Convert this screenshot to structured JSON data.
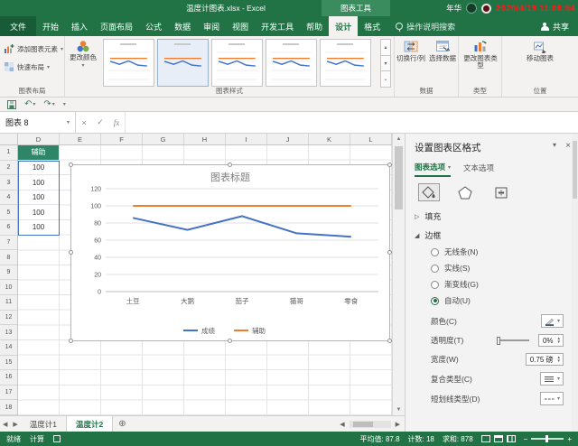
{
  "colors": {
    "excel_green": "#217346",
    "series_blue": "#4472c4",
    "series_orange": "#ed7d31",
    "d1_fill": "#2e8568"
  },
  "title_bar": {
    "window_title": "温度计图表.xlsx - Excel",
    "context_title": "图表工具",
    "user_name": "年华",
    "timestamp": "2020/4/19 11:06:54"
  },
  "ribbon": {
    "file_tab": "文件",
    "tabs": [
      {
        "label": "开始"
      },
      {
        "label": "插入"
      },
      {
        "label": "页面布局"
      },
      {
        "label": "公式"
      },
      {
        "label": "数据"
      },
      {
        "label": "审阅"
      },
      {
        "label": "视图"
      },
      {
        "label": "开发工具"
      },
      {
        "label": "帮助"
      },
      {
        "label": "设计",
        "active": true
      },
      {
        "label": "格式"
      }
    ],
    "search_label": "操作说明搜索",
    "share_label": "共享",
    "groups": [
      {
        "label": "图表布局"
      },
      {
        "label": "图表样式"
      },
      {
        "label": "数据"
      },
      {
        "label": "类型"
      },
      {
        "label": "位置"
      }
    ],
    "add_chart_element": "添加图表元素",
    "quick_layout": "快速布局",
    "change_colors": "更改颜色",
    "switch_row_col": "切换行/列",
    "select_data": "选择数据",
    "change_chart_type": "更改图表类型",
    "move_chart": "移动图表"
  },
  "formula_bar": {
    "name_box": "图表 8"
  },
  "sheet": {
    "columns": [
      "D",
      "E",
      "F",
      "G",
      "H",
      "I",
      "J",
      "K",
      "L"
    ],
    "row_numbers": [
      "1",
      "2",
      "3",
      "4",
      "5",
      "6",
      "7",
      "8",
      "9",
      "10",
      "11",
      "12",
      "13",
      "14",
      "15",
      "16",
      "17",
      "18"
    ],
    "d1_value": "辅助",
    "d_values": [
      "100",
      "100",
      "100",
      "100",
      "100"
    ],
    "tabs": [
      {
        "label": "温度计1"
      },
      {
        "label": "温度计2",
        "active": true
      }
    ]
  },
  "chart_data": {
    "type": "line",
    "title": "图表标题",
    "categories": [
      "土豆",
      "大鹅",
      "茄子",
      "猫哥",
      "零食"
    ],
    "series": [
      {
        "name": "成绩",
        "color": "#4472c4",
        "values": [
          86,
          72,
          88,
          68,
          64
        ]
      },
      {
        "name": "辅助",
        "color": "#ed7d31",
        "values": [
          100,
          100,
          100,
          100,
          100
        ]
      }
    ],
    "ylim": [
      0,
      120
    ],
    "yticks": [
      0,
      20,
      40,
      60,
      80,
      100,
      120
    ],
    "grid": true,
    "legend_position": "bottom"
  },
  "format_pane": {
    "title": "设置图表区格式",
    "tab_chart_options": "图表选项",
    "tab_text_options": "文本选项",
    "section_fill": "填充",
    "section_border": "边框",
    "border_options": [
      {
        "label": "无线条(N)"
      },
      {
        "label": "实线(S)"
      },
      {
        "label": "渐变线(G)"
      },
      {
        "label": "自动(U)",
        "selected": true
      }
    ],
    "color_label": "颜色(C)",
    "transparency_label": "透明度(T)",
    "transparency_value": "0%",
    "width_label": "宽度(W)",
    "width_value": "0.75 磅",
    "compound_type_label": "复合类型(C)",
    "dash_type_label": "短划线类型(D)"
  },
  "status_bar": {
    "ready": "就绪",
    "calc": "计算",
    "average": "平均值: 87.8",
    "count": "计数: 18",
    "sum": "求和: 878"
  }
}
